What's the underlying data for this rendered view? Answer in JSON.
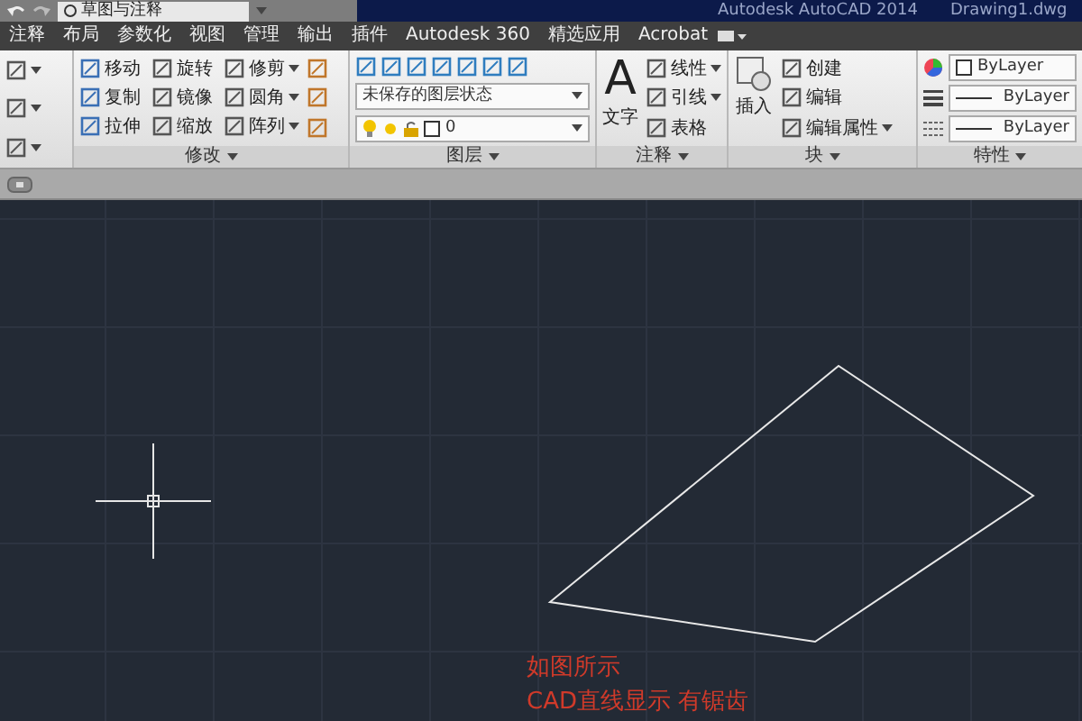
{
  "quick_access": {
    "workspace": "草图与注释"
  },
  "title_bar": {
    "app": "Autodesk AutoCAD 2014",
    "file": "Drawing1.dwg"
  },
  "tabs": [
    {
      "label": "注释",
      "selected": false
    },
    {
      "label": "布局",
      "selected": false
    },
    {
      "label": "参数化",
      "selected": false
    },
    {
      "label": "视图",
      "selected": false
    },
    {
      "label": "管理",
      "selected": false
    },
    {
      "label": "输出",
      "selected": false
    },
    {
      "label": "插件",
      "selected": false
    },
    {
      "label": "Autodesk 360",
      "selected": false
    },
    {
      "label": "精选应用",
      "selected": false
    },
    {
      "label": "Acrobat",
      "selected": false
    }
  ],
  "modify_panel": {
    "title": "修改",
    "tools": [
      {
        "label": "移动",
        "dropdown": false
      },
      {
        "label": "旋转",
        "dropdown": false
      },
      {
        "label": "修剪",
        "dropdown": true
      },
      {
        "label": "复制",
        "dropdown": false
      },
      {
        "label": "镜像",
        "dropdown": false
      },
      {
        "label": "圆角",
        "dropdown": true
      },
      {
        "label": "拉伸",
        "dropdown": false
      },
      {
        "label": "缩放",
        "dropdown": false
      },
      {
        "label": "阵列",
        "dropdown": true
      }
    ]
  },
  "layer_panel": {
    "title": "图层",
    "layer_state": "未保存的图层状态",
    "current_layer": "0"
  },
  "annotation_panel": {
    "title": "注释",
    "text_glyph": "A",
    "text_tool": "文字",
    "tools": [
      {
        "label": "线性",
        "dropdown": true
      },
      {
        "label": "引线",
        "dropdown": true
      },
      {
        "label": "表格",
        "dropdown": false
      }
    ]
  },
  "block_panel": {
    "title": "块",
    "insert": "插入",
    "tools": [
      {
        "label": "创建",
        "dropdown": false
      },
      {
        "label": "编辑",
        "dropdown": false
      },
      {
        "label": "编辑属性",
        "dropdown": true
      }
    ]
  },
  "properties_panel": {
    "title": "特性",
    "color_setting": "ByLayer",
    "linetype": "ByLayer",
    "lineweight": "ByLayer"
  },
  "canvas": {
    "notes": [
      "如图所示",
      "CAD直线显示 有锯齿"
    ]
  }
}
